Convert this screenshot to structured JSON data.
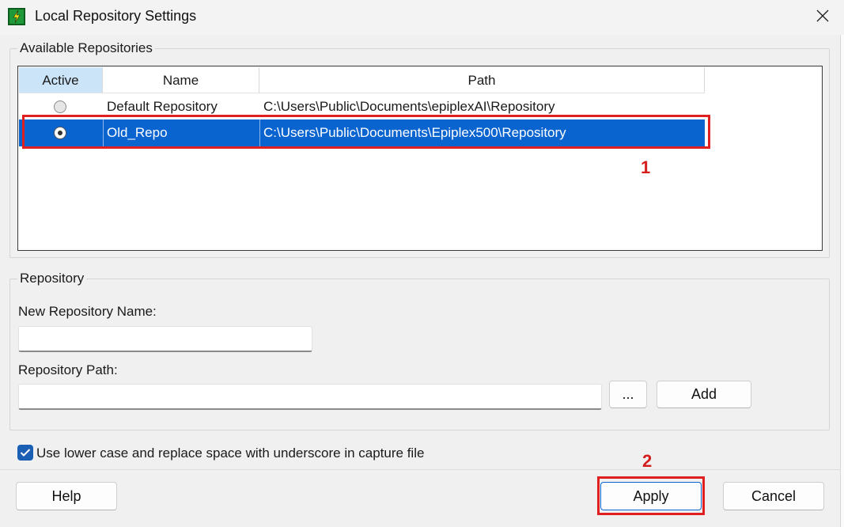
{
  "window": {
    "title": "Local Repository Settings"
  },
  "available_repositories": {
    "group_label": "Available Repositories",
    "columns": [
      "Active",
      "Name",
      "Path"
    ],
    "rows": [
      {
        "active": false,
        "name": "Default Repository",
        "path": "C:\\Users\\Public\\Documents\\epiplexAI\\Repository",
        "selected": false
      },
      {
        "active": true,
        "name": "Old_Repo",
        "path": "C:\\Users\\Public\\Documents\\Epiplex500\\Repository",
        "selected": true
      }
    ]
  },
  "repository": {
    "group_label": "Repository",
    "new_name_label": "New Repository Name:",
    "new_name_value": "",
    "path_label": "Repository Path:",
    "path_value": "",
    "browse_label": "...",
    "add_label": "Add"
  },
  "options": {
    "lowercase_checkbox_label": "Use lower case and replace space with underscore in capture file",
    "lowercase_checked": true
  },
  "footer": {
    "help_label": "Help",
    "apply_label": "Apply",
    "cancel_label": "Cancel"
  },
  "annotations": {
    "marker_1": "1",
    "marker_2": "2"
  },
  "colors": {
    "selection": "#0a64d0",
    "annotation": "#e02020",
    "checkbox": "#1a5fb4",
    "app_icon": "#1f9a3a"
  },
  "icons": {
    "app": "app-logo-icon",
    "close": "close-icon",
    "check": "check-icon"
  }
}
